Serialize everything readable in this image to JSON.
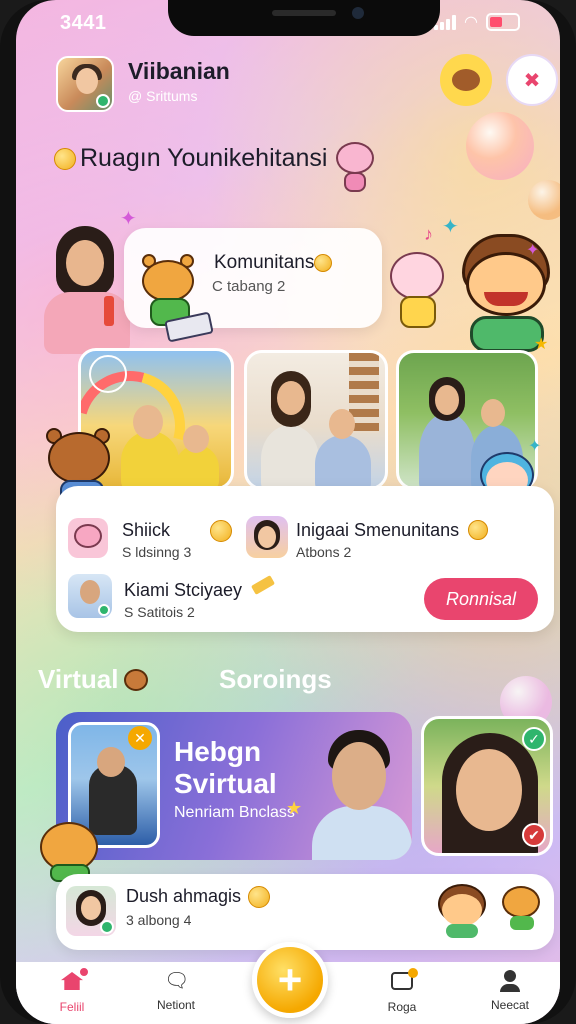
{
  "status": {
    "time": "3441"
  },
  "header": {
    "app_name": "Viibanian",
    "subtitle": "@ Srittums"
  },
  "section1": {
    "title": "Ruagın Younikehitansi"
  },
  "community_card": {
    "title": "Komunitans",
    "subtitle": "C tabang 2"
  },
  "list": [
    {
      "title": "Shiick",
      "subtitle": "S ldsinng 3"
    },
    {
      "title": "Inigaai Smenunitans",
      "subtitle": "Atbons 2"
    },
    {
      "title": "Kiami Stciyaey",
      "subtitle": "S Satitois 2"
    }
  ],
  "primary_button": {
    "label": "Ronnisal"
  },
  "section2": {
    "left": "Virtual",
    "right": "Soroings"
  },
  "feature": {
    "line1": "Hebgn",
    "line2": "Svirtual",
    "caption": "Nenriam Bnclass"
  },
  "bottom_item": {
    "title": "Dush ahmagis",
    "subtitle": "3 albong 4"
  },
  "tabs": [
    {
      "label": "Feliil",
      "icon": "home-icon",
      "badge": ""
    },
    {
      "label": "Netiont",
      "icon": "chat-icon"
    },
    {
      "label": "Roga",
      "icon": "camera-icon"
    },
    {
      "label": "Neecat",
      "icon": "profile-icon"
    }
  ],
  "colors": {
    "accent": "#e9456e",
    "fab": "#f5a800",
    "online": "#2fb56d"
  }
}
